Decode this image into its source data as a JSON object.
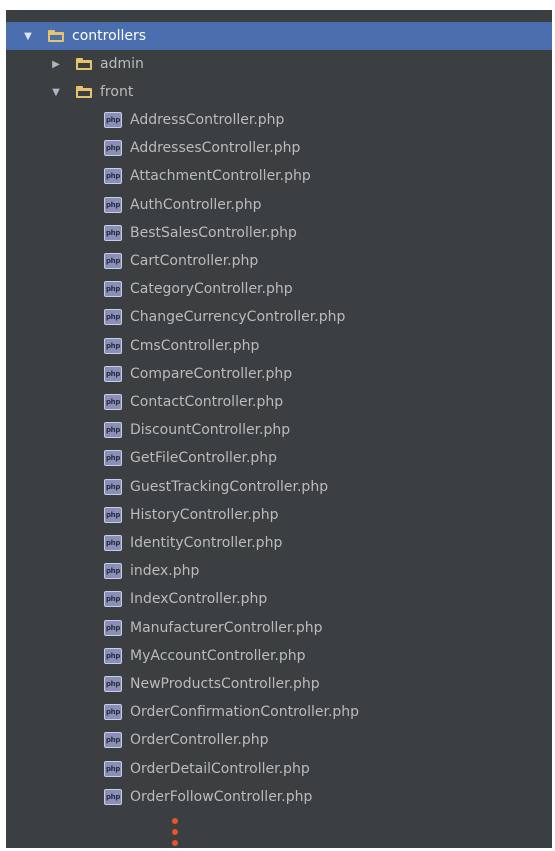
{
  "tree": {
    "root": {
      "label": "controllers",
      "expanded": true,
      "selected": true,
      "icon": "folder-icon"
    },
    "folders": [
      {
        "label": "admin",
        "expanded": false,
        "icon": "folder-icon"
      },
      {
        "label": "front",
        "expanded": true,
        "icon": "folder-icon"
      }
    ],
    "files": [
      "AddressController.php",
      "AddressesController.php",
      "AttachmentController.php",
      "AuthController.php",
      "BestSalesController.php",
      "CartController.php",
      "CategoryController.php",
      "ChangeCurrencyController.php",
      "CmsController.php",
      "CompareController.php",
      "ContactController.php",
      "DiscountController.php",
      "GetFileController.php",
      "GuestTrackingController.php",
      "HistoryController.php",
      "IdentityController.php",
      "index.php",
      "IndexController.php",
      "ManufacturerController.php",
      "MyAccountController.php",
      "NewProductsController.php",
      "OrderConfirmationController.php",
      "OrderController.php",
      "OrderDetailController.php",
      "OrderFollowController.php"
    ],
    "file_icon_text": "php",
    "file_icon": "php-file-icon",
    "more_indicator_icon": "vertical-ellipsis-icon"
  },
  "colors": {
    "panel_background": "#3c3f41",
    "selection": "#4b6eaf",
    "text": "#bbbbbb",
    "folder": "#e6c36b",
    "ellipsis": "#e8542a"
  }
}
